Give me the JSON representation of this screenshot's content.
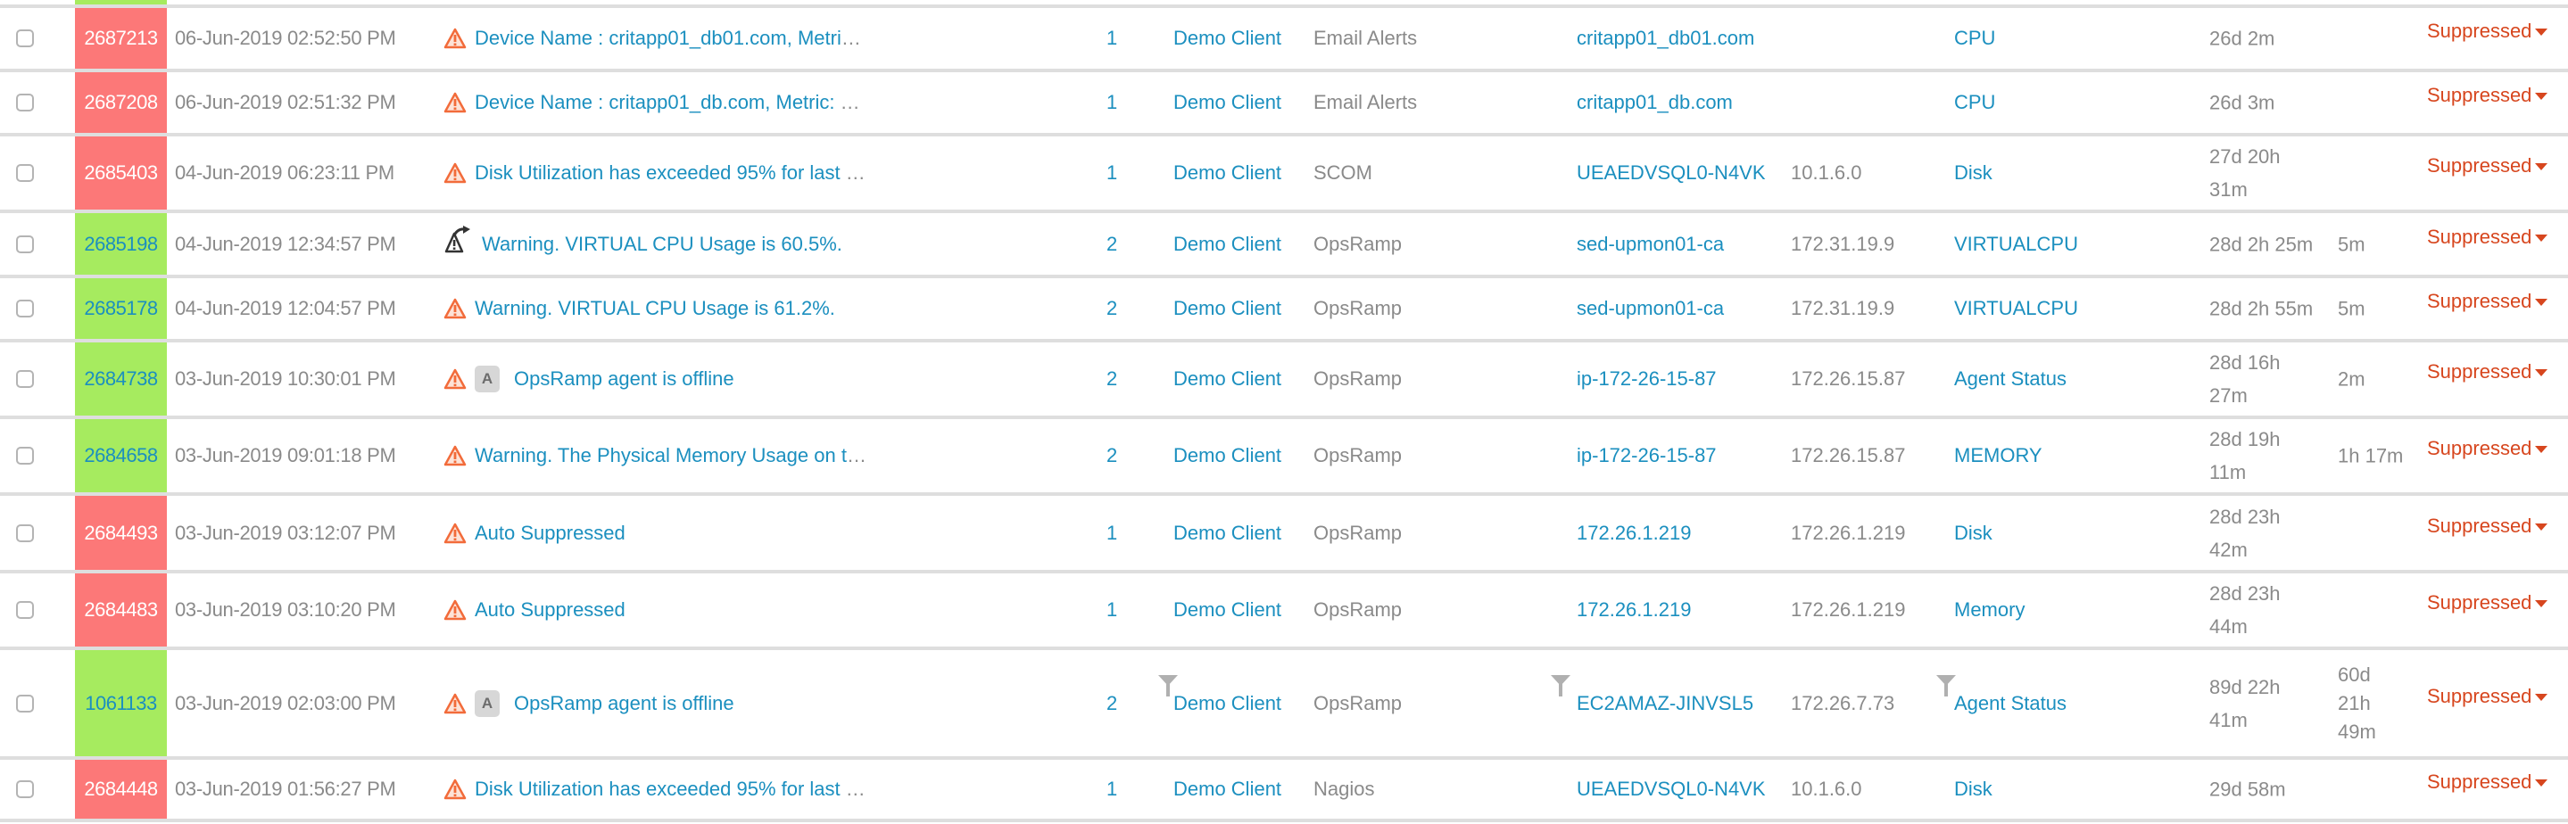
{
  "colors": {
    "critical": "#fc7878",
    "ok": "#a6eb5f",
    "link": "#1b8fbf",
    "muted": "#8a8a8a",
    "status": "#d7461e",
    "divider": "#dedede"
  },
  "alerts": [
    {
      "id": "2687213",
      "severity": "critical",
      "date": "06-Jun-2019 02:52:50 PM",
      "icon": "warning-triangle-icon",
      "badge": "",
      "title": "Device Name : critapp01_db01.com, Metri",
      "truncated": true,
      "count": "1",
      "client": "Demo Client",
      "source": "Email Alerts",
      "resource": "critapp01_db01.com",
      "ip": "",
      "metric": "CPU",
      "duration": [
        "26d 2m"
      ],
      "elapsed": [],
      "status": "Suppressed"
    },
    {
      "id": "2687208",
      "severity": "critical",
      "date": "06-Jun-2019 02:51:32 PM",
      "icon": "warning-triangle-icon",
      "badge": "",
      "title": "Device Name : critapp01_db.com, Metric: ",
      "truncated": true,
      "count": "1",
      "client": "Demo Client",
      "source": "Email Alerts",
      "resource": "critapp01_db.com",
      "ip": "",
      "metric": "CPU",
      "duration": [
        "26d 3m"
      ],
      "elapsed": [],
      "status": "Suppressed"
    },
    {
      "id": "2685403",
      "severity": "critical",
      "date": "04-Jun-2019 06:23:11 PM",
      "icon": "warning-triangle-icon",
      "badge": "",
      "title": "Disk Utilization has exceeded 95% for last ",
      "truncated": true,
      "count": "1",
      "client": "Demo Client",
      "source": "SCOM",
      "resource": "UEAEDVSQL0-N4VK",
      "ip": "10.1.6.0",
      "metric": "Disk",
      "duration": [
        "27d 20h",
        "31m"
      ],
      "elapsed": [],
      "status": "Suppressed"
    },
    {
      "id": "2685198",
      "severity": "ok",
      "date": "04-Jun-2019 12:34:57 PM",
      "icon": "escalated-warning-icon",
      "badge": "",
      "title": "Warning. VIRTUAL CPU Usage is 60.5%.",
      "truncated": false,
      "count": "2",
      "client": "Demo Client",
      "source": "OpsRamp",
      "resource": "sed-upmon01-ca",
      "ip": "172.31.19.9",
      "metric": "VIRTUALCPU",
      "duration": [
        "28d 2h 25m"
      ],
      "elapsed": [
        "5m"
      ],
      "status": "Suppressed"
    },
    {
      "id": "2685178",
      "severity": "ok",
      "date": "04-Jun-2019 12:04:57 PM",
      "icon": "warning-triangle-icon",
      "badge": "",
      "title": "Warning. VIRTUAL CPU Usage is 61.2%.",
      "truncated": false,
      "count": "2",
      "client": "Demo Client",
      "source": "OpsRamp",
      "resource": "sed-upmon01-ca",
      "ip": "172.31.19.9",
      "metric": "VIRTUALCPU",
      "duration": [
        "28d 2h 55m"
      ],
      "elapsed": [
        "5m"
      ],
      "status": "Suppressed"
    },
    {
      "id": "2684738",
      "severity": "ok",
      "date": "03-Jun-2019 10:30:01 PM",
      "icon": "warning-triangle-icon",
      "badge": "A",
      "title": "OpsRamp agent is offline",
      "truncated": false,
      "count": "2",
      "client": "Demo Client",
      "source": "OpsRamp",
      "resource": "ip-172-26-15-87",
      "ip": "172.26.15.87",
      "metric": "Agent Status",
      "duration": [
        "28d 16h",
        "27m"
      ],
      "elapsed": [
        "2m"
      ],
      "status": "Suppressed"
    },
    {
      "id": "2684658",
      "severity": "ok",
      "date": "03-Jun-2019 09:01:18 PM",
      "icon": "warning-triangle-icon",
      "badge": "",
      "title": "Warning. The Physical Memory Usage on t",
      "truncated": true,
      "count": "2",
      "client": "Demo Client",
      "source": "OpsRamp",
      "resource": "ip-172-26-15-87",
      "ip": "172.26.15.87",
      "metric": "MEMORY",
      "duration": [
        "28d 19h",
        "11m"
      ],
      "elapsed": [
        "1h 17m"
      ],
      "status": "Suppressed"
    },
    {
      "id": "2684493",
      "severity": "critical",
      "date": "03-Jun-2019 03:12:07 PM",
      "icon": "warning-triangle-icon",
      "badge": "",
      "title": "Auto Suppressed",
      "truncated": false,
      "count": "1",
      "client": "Demo Client",
      "source": "OpsRamp",
      "resource": "172.26.1.219",
      "ip": "172.26.1.219",
      "metric": "Disk",
      "duration": [
        "28d 23h",
        "42m"
      ],
      "elapsed": [],
      "status": "Suppressed"
    },
    {
      "id": "2684483",
      "severity": "critical",
      "date": "03-Jun-2019 03:10:20 PM",
      "icon": "warning-triangle-icon",
      "badge": "",
      "title": "Auto Suppressed",
      "truncated": false,
      "count": "1",
      "client": "Demo Client",
      "source": "OpsRamp",
      "resource": "172.26.1.219",
      "ip": "172.26.1.219",
      "metric": "Memory",
      "duration": [
        "28d 23h",
        "44m"
      ],
      "elapsed": [],
      "status": "Suppressed"
    },
    {
      "id": "1061133",
      "severity": "ok",
      "date": "03-Jun-2019 02:03:00 PM",
      "icon": "warning-triangle-icon",
      "badge": "A",
      "title": "OpsRamp agent is offline",
      "truncated": false,
      "count": "2",
      "client": "Demo Client",
      "source": "OpsRamp",
      "resource": "EC2AMAZ-JINVSL5",
      "ip": "172.26.7.73",
      "metric": "Agent Status",
      "duration": [
        "89d 22h",
        "41m"
      ],
      "elapsed": [
        "60d",
        "21h",
        "49m"
      ],
      "status": "Suppressed",
      "filters": [
        "client",
        "resource",
        "metric"
      ]
    },
    {
      "id": "2684448",
      "severity": "critical",
      "date": "03-Jun-2019 01:56:27 PM",
      "icon": "warning-triangle-icon",
      "badge": "",
      "title": "Disk Utilization has exceeded 95% for last ",
      "truncated": true,
      "count": "1",
      "client": "Demo Client",
      "source": "Nagios",
      "resource": "UEAEDVSQL0-N4VK",
      "ip": "10.1.6.0",
      "metric": "Disk",
      "duration": [
        "29d 58m"
      ],
      "elapsed": [],
      "status": "Suppressed"
    }
  ],
  "ellipsis": "…"
}
